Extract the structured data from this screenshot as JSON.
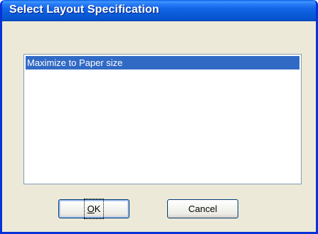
{
  "window": {
    "title": "Select Layout Specification"
  },
  "list": {
    "items": [
      {
        "label": "Maximize to Paper size",
        "selected": true
      }
    ]
  },
  "buttons": {
    "ok_accel": "O",
    "ok_rest": "K",
    "cancel_label": "Cancel"
  },
  "colors": {
    "titlebar": "#0a5ee8",
    "dialog_bg": "#ece9d8",
    "selection": "#316ac5",
    "frame_border": "#0831d9"
  }
}
